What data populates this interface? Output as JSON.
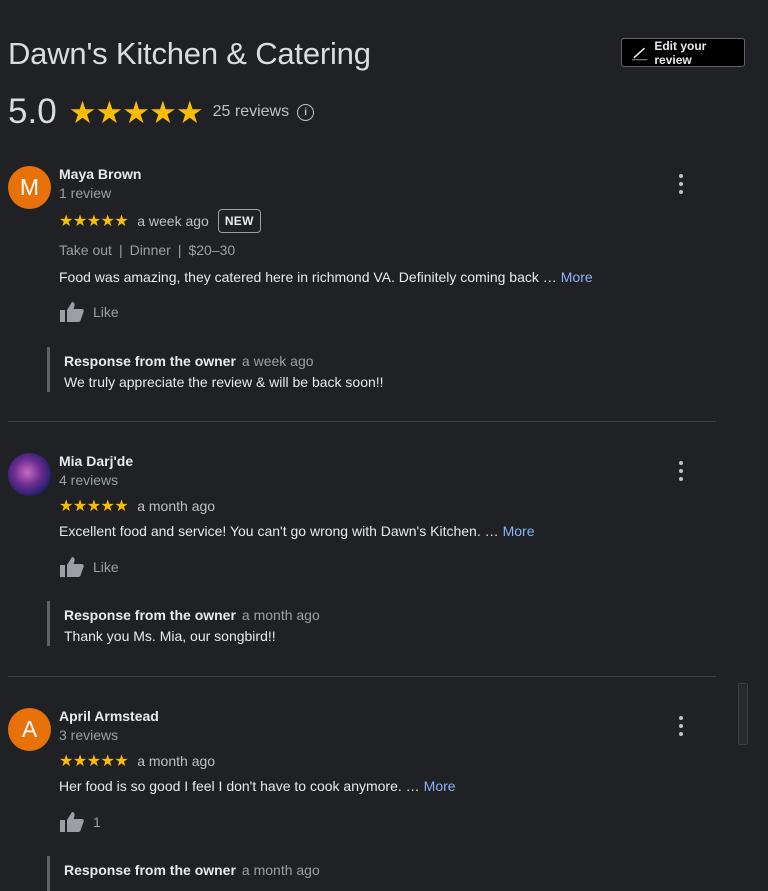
{
  "header": {
    "title": "Dawn's Kitchen & Catering",
    "edit_button_label": "Edit your review",
    "rating": "5.0",
    "stars": "★★★★★",
    "review_count": "25 reviews",
    "info_glyph": "i"
  },
  "reviews": [
    {
      "avatar_letter": "M",
      "avatar_color": "#e8710a",
      "name": "Maya Brown",
      "sub": "1 review",
      "stars": "★★★★★",
      "when": "a week ago",
      "badge": "NEW",
      "meta": [
        "Take out",
        "Dinner",
        "$20–30"
      ],
      "meta_sep": "|",
      "text": "Food was amazing, they catered here in richmond VA. Definitely coming back …",
      "more": "More",
      "like": "Like",
      "owner_label": "Response from the owner",
      "owner_when": "a week ago",
      "owner_text": "We truly appreciate the review & will be back soon!!"
    },
    {
      "avatar_letter": "",
      "name": "Mia Darj'de",
      "sub": "4 reviews",
      "stars": "★★★★★",
      "when": "a month ago",
      "text": "Excellent food and service!  You can't go wrong with Dawn's Kitchen. …",
      "more": "More",
      "like": "Like",
      "owner_label": "Response from the owner",
      "owner_when": "a month ago",
      "owner_text": "Thank you Ms. Mia, our songbird!!"
    },
    {
      "avatar_letter": "A",
      "avatar_color": "#e8710a",
      "name": "April Armstead",
      "sub": "3 reviews",
      "stars": "★★★★★",
      "when": "a month ago",
      "text": "Her food is so good I feel I don't have to cook anymore. …",
      "more": "More",
      "like": "1",
      "owner_label": "Response from the owner",
      "owner_when": "a month ago"
    }
  ],
  "icons": {
    "pencil": "pencil-icon",
    "info": "info-icon",
    "more": "more-vert-icon",
    "thumb": "thumb-up-icon"
  },
  "colors": {
    "background": "#202124",
    "star": "#fbbc04",
    "link": "#8ab4f8"
  }
}
